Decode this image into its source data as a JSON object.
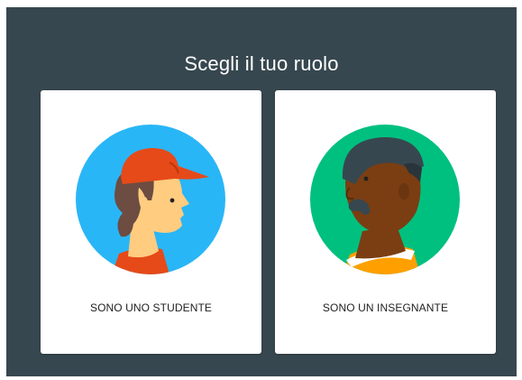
{
  "page": {
    "title": "Scegli il tuo ruolo"
  },
  "roles": [
    {
      "label": "SONO UNO STUDENTE",
      "icon": "student-avatar-icon",
      "circle_color": "#29b6f6"
    },
    {
      "label": "SONO UN INSEGNANTE",
      "icon": "teacher-avatar-icon",
      "circle_color": "#00c07f"
    }
  ],
  "colors": {
    "background": "#37474f",
    "card": "#ffffff",
    "text": "#212121"
  }
}
